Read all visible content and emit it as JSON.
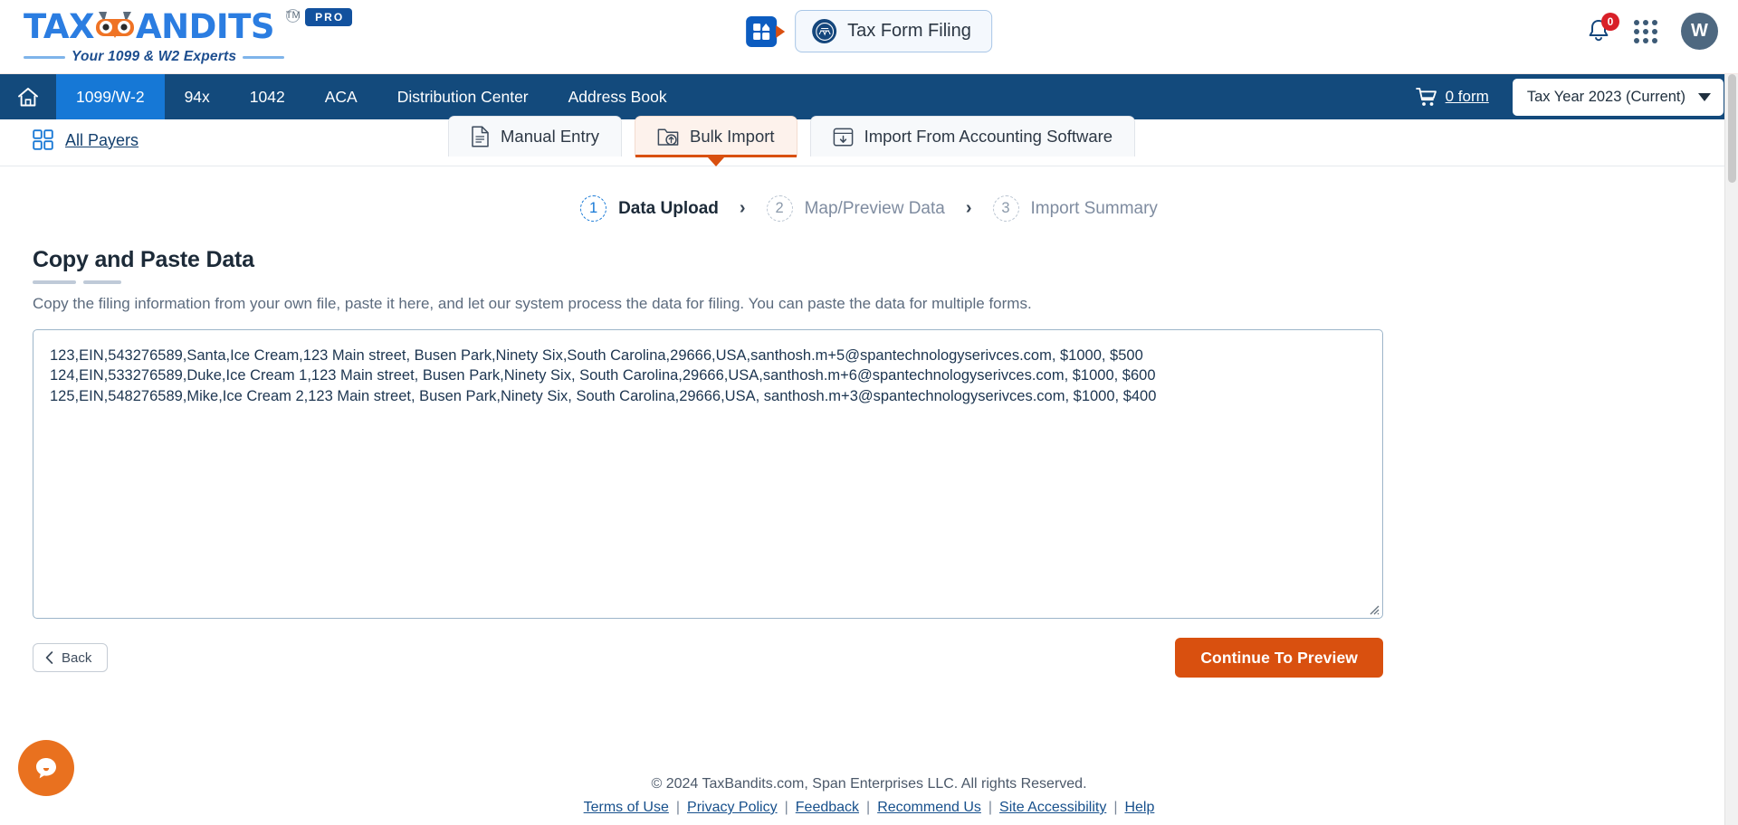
{
  "brand": {
    "name_part1": "TAX",
    "name_part2": "ANDITS",
    "tagline": "Your 1099 & W2 Experts",
    "tm": "TM",
    "pro_badge": "PRO",
    "accent_blue": "#2b7de1",
    "accent_orange": "#d9500f"
  },
  "header": {
    "app_switcher_icon": "grid-launcher-icon",
    "filing_pill_label": "Tax Form Filing",
    "filing_pill_icon": "irs-seal-icon",
    "notification_icon": "bell-icon",
    "notification_count": "0",
    "apps_icon": "apps-grid-icon",
    "avatar_initial": "W"
  },
  "mainnav": {
    "home_icon": "home-icon",
    "items": [
      {
        "label": "1099/W-2",
        "active": true
      },
      {
        "label": "94x",
        "active": false
      },
      {
        "label": "1042",
        "active": false
      },
      {
        "label": "ACA",
        "active": false
      },
      {
        "label": "Distribution Center",
        "active": false
      },
      {
        "label": "Address Book",
        "active": false
      }
    ],
    "cart_icon": "cart-icon",
    "cart_label": "0 form",
    "tax_year_value": "Tax Year 2023 (Current)"
  },
  "subrow": {
    "all_payers_icon": "grid-squares-icon",
    "all_payers_label": "All Payers",
    "tabs": [
      {
        "label": "Manual Entry",
        "icon": "document-icon",
        "active": false
      },
      {
        "label": "Bulk Import",
        "icon": "folder-upload-icon",
        "active": true
      },
      {
        "label": "Import From Accounting Software",
        "icon": "box-download-icon",
        "active": false
      }
    ]
  },
  "stepper": {
    "separator": "›",
    "steps": [
      {
        "num": "1",
        "label": "Data Upload",
        "active": true
      },
      {
        "num": "2",
        "label": "Map/Preview Data",
        "active": false
      },
      {
        "num": "3",
        "label": "Import Summary",
        "active": false
      }
    ]
  },
  "main": {
    "title": "Copy and Paste Data",
    "description": "Copy the filing information from your own file, paste it here, and let our system process the data for filing. You can paste the data for multiple forms.",
    "paste_value_lines": [
      "123,EIN,543276589,Santa,Ice Cream,123 Main street, Busen Park,Ninety Six,South Carolina,29666,USA,santhosh.m+5@spantechnologyserivces.com, $1000, $500",
      "124,EIN,533276589,Duke,Ice Cream 1,123 Main street, Busen Park,Ninety Six, South Carolina,29666,USA,santhosh.m+6@spantechnologyserivces.com, $1000, $600",
      "125,EIN,548276589,Mike,Ice Cream 2,123 Main street, Busen Park,Ninety Six, South Carolina,29666,USA, santhosh.m+3@spantechnologyserivces.com, $1000, $400"
    ],
    "back_label": "Back",
    "back_icon": "chevron-left-icon",
    "continue_label": "Continue To Preview"
  },
  "footer": {
    "copyright": "© 2024 TaxBandits.com, Span Enterprises LLC. All rights Reserved.",
    "links": [
      "Terms of Use",
      "Privacy Policy",
      "Feedback",
      "Recommend Us",
      "Site Accessibility",
      "Help"
    ],
    "separator": "|"
  },
  "chat": {
    "icon": "chat-bubble-icon"
  }
}
